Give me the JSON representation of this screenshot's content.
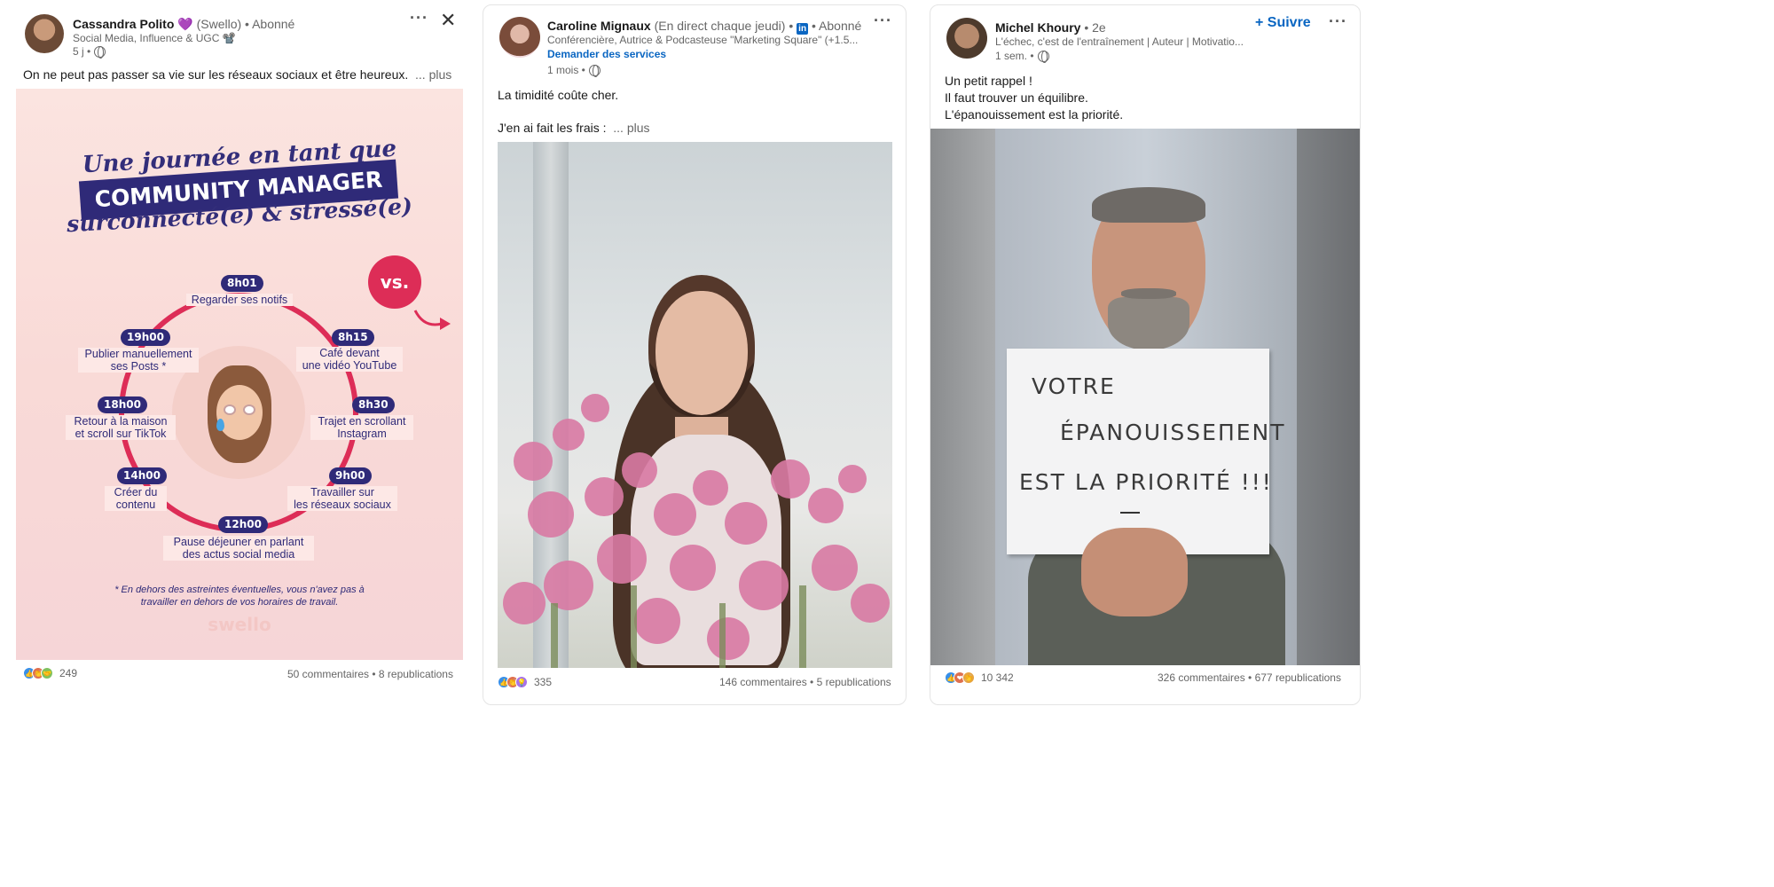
{
  "post1": {
    "author": "Cassandra Polito",
    "author_emoji": "💜",
    "author_suffix": "(Swello) • Abonné",
    "subtitle": "Social Media, Influence & UGC 📽️",
    "time": "5 j •",
    "text": "On ne peut pas passer sa vie sur les réseaux sociaux et être heureux.",
    "more": "... plus",
    "more_icon": "more-horizontal-icon",
    "close_icon": "close-icon",
    "infographic": {
      "title_line1": "Une journée en tant que",
      "banner": "COMMUNITY MANAGER",
      "title_line3": "surconnecté(e) & stressé(e)",
      "vs": "vs.",
      "steps": [
        {
          "time": "8h01",
          "label": "Regarder ses notifs"
        },
        {
          "time": "8h15",
          "label": "Café devant\nune vidéo YouTube"
        },
        {
          "time": "8h30",
          "label": "Trajet en scrollant\nInstagram"
        },
        {
          "time": "9h00",
          "label": "Travailler sur\nles réseaux sociaux"
        },
        {
          "time": "12h00",
          "label": "Pause déjeuner en parlant\ndes actus social media"
        },
        {
          "time": "14h00",
          "label": "Créer du\ncontenu"
        },
        {
          "time": "18h00",
          "label": "Retour à la maison\net scroll sur TikTok"
        },
        {
          "time": "19h00",
          "label": "Publier manuellement\nses Posts *"
        }
      ],
      "footnote": "* En dehors des astreintes éventuelles, vous n'avez pas à\ntravailler en dehors de vos horaires de travail.",
      "brand": "swello"
    },
    "reactions_count": "249",
    "comments_reposts": "50 commentaires • 8 republications"
  },
  "post2": {
    "author": "Caroline Mignaux",
    "author_suffix": "(En direct chaque jeudi) •",
    "follow_state": "• Abonné",
    "subtitle": "Conférencière, Autrice & Podcasteuse \"Marketing Square\" (+1.5...",
    "cta": "Demander des services",
    "time": "1 mois •",
    "text_line1": "La timidité coûte cher.",
    "text_line2": "J'en ai fait les frais :",
    "more": "... plus",
    "more_icon": "more-horizontal-icon",
    "reactions_count": "335",
    "comments_reposts": "146 commentaires • 5 republications"
  },
  "post3": {
    "author": "Michel Khoury",
    "degree": "• 2e",
    "follow": "+ Suivre",
    "subtitle": "L'échec, c'est de l'entraînement | Auteur | Motivatio...",
    "time": "1 sem. •",
    "text_lines": [
      "Un petit rappel !",
      "Il faut trouver un équilibre.",
      "L'épanouissement est la priorité."
    ],
    "sign_lines": [
      "VOTRE",
      "ÉPANOUISSEΠENT",
      "EST LA PRIORITÉ !!!"
    ],
    "more_icon": "more-horizontal-icon",
    "reactions_count": "10 342",
    "comments_reposts": "326 commentaires • 677 republications"
  },
  "colors": {
    "link_blue": "#0a66c2",
    "infographic_navy": "#2f2a78",
    "infographic_red": "#dd2d57"
  }
}
